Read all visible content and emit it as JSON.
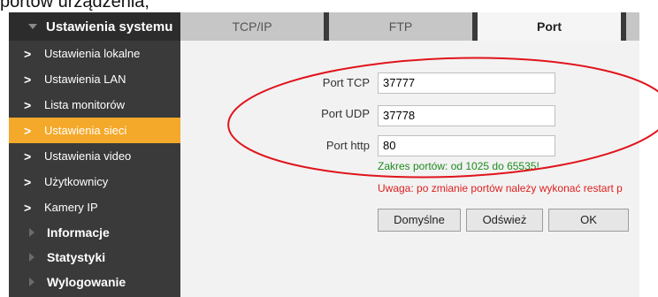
{
  "top_fragment": "portów urządzenia,",
  "sidebar": {
    "header": "Ustawienia systemu",
    "items": [
      {
        "label": "Ustawienia lokalne"
      },
      {
        "label": "Ustawienia LAN"
      },
      {
        "label": "Lista monitorów"
      },
      {
        "label": "Ustawienia sieci"
      },
      {
        "label": "Ustawienia video"
      },
      {
        "label": "Użytkownicy"
      },
      {
        "label": "Kamery IP"
      }
    ],
    "active_index": 3,
    "sections": [
      {
        "label": "Informacje"
      },
      {
        "label": "Statystyki"
      },
      {
        "label": "Wylogowanie"
      }
    ]
  },
  "tabs": [
    {
      "label": "TCP/IP"
    },
    {
      "label": "FTP"
    },
    {
      "label": "Port"
    }
  ],
  "active_tab": "Port",
  "form": {
    "tcp": {
      "label": "Port TCP",
      "value": "37777"
    },
    "udp": {
      "label": "Port UDP",
      "value": "37778"
    },
    "http": {
      "label": "Port http",
      "value": "80"
    }
  },
  "notes": {
    "range": "Zakres portów: od 1025 do 65535!",
    "warning": "Uwaga: po zmianie portów należy wykonać restart p"
  },
  "buttons": {
    "default": "Domyślne",
    "refresh": "Odśwież",
    "ok": "OK"
  },
  "colors": {
    "active_item": "#f4a92a",
    "annotation": "#e0141c",
    "note_green": "#1e8b1e",
    "note_red": "#e02020"
  }
}
